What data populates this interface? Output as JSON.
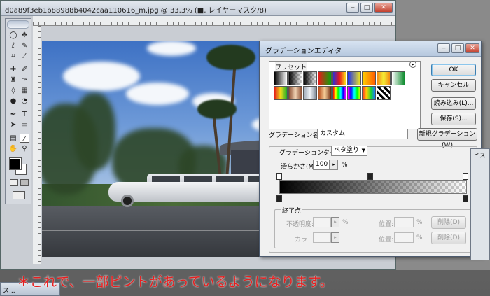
{
  "document": {
    "title": "d0a89f3eb1b88988b4042caa110616_m.jpg @ 33.3% (■, レイヤーマスク/8)"
  },
  "window_buttons": {
    "minimize": "‒",
    "maximize": "□",
    "close": "✕"
  },
  "dialog": {
    "title": "グラデーションエディタ",
    "presets_label": "プリセット",
    "ok": "OK",
    "cancel": "キャンセル",
    "load": "読み込み(L)...",
    "save": "保存(S)...",
    "name_label": "グラデーション名(N):",
    "name_value": "カスタム",
    "new_button": "新規グラデーション(W)",
    "type_label": "グラデーションタイプ(T):",
    "type_value": "ベタ塗り",
    "smooth_label": "滑らかさ(M):",
    "smooth_value": "100",
    "smooth_unit": "%",
    "stops_group": "終了点",
    "opacity_label": "不透明度:",
    "color_label": "カラー:",
    "location_label": "位置:",
    "percent": "%",
    "delete": "削除(D)"
  },
  "presets": [
    "#000000,#ffffff",
    "#000000,#ffffff00",
    "#000000,#00000000",
    "#e81919,#09a40c",
    "#2f2fd8,#e71818,#ffe119",
    "#1e2ff0,#f3ea19",
    "#ffd000,#ff5b00",
    "#f48a15,#f5ee35,#f48a15",
    "#ffffff,#0c8a2c",
    "#e31b1b,#f0e019,#1caa2b",
    "#8a4b2f,#f2d5b5,#8a4b2f",
    "#9fa9b6,#eef2f7,#7a8592",
    "#b54d1b,#f6cf9a,#6f2a0f",
    "#ff0000,#ffff00,#00ff00,#00ffff,#0000ff,#ff00ff",
    "#ff00ff,#0000ff,#00ffff,#00ff00,#ffff00",
    "#ff2f2f,#ffd200,#19d433,#1f7bff",
    "stripes"
  ],
  "caption": "＊これで、一部ピントがあっているようになります。",
  "panel_right": {
    "label": "ヒス"
  },
  "taskbar": {
    "label": "ス..."
  }
}
